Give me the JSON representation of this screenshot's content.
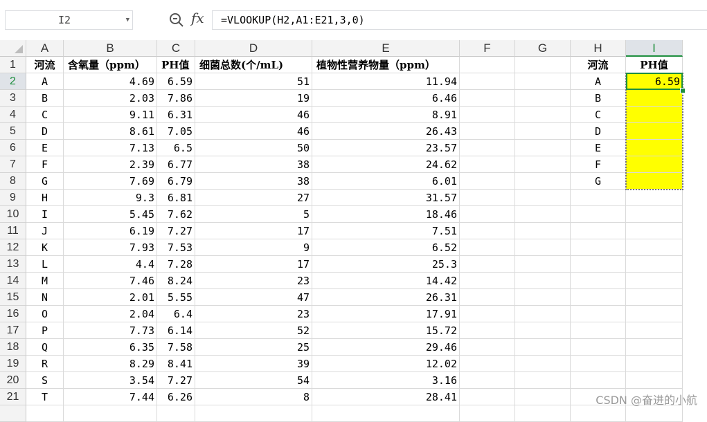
{
  "formula_bar": {
    "name_box": "I2",
    "fx_label": "fx",
    "formula": "=VLOOKUP(H2,A1:E21,3,0)"
  },
  "columns": [
    "A",
    "B",
    "C",
    "D",
    "E",
    "F",
    "G",
    "H",
    "I"
  ],
  "selected_column": "I",
  "selected_row": "2",
  "row_numbers": [
    "1",
    "2",
    "3",
    "4",
    "5",
    "6",
    "7",
    "8",
    "9",
    "10",
    "11",
    "12",
    "13",
    "14",
    "15",
    "16",
    "17",
    "18",
    "19",
    "20",
    "21"
  ],
  "table": {
    "headers": [
      "河流",
      "含氧量（ppm）",
      "PH值",
      "细菌总数(个/mL)",
      "植物性营养物量（ppm）"
    ],
    "rows": [
      [
        "A",
        "4.69",
        "6.59",
        "51",
        "11.94"
      ],
      [
        "B",
        "2.03",
        "7.86",
        "19",
        "6.46"
      ],
      [
        "C",
        "9.11",
        "6.31",
        "46",
        "8.91"
      ],
      [
        "D",
        "8.61",
        "7.05",
        "46",
        "26.43"
      ],
      [
        "E",
        "7.13",
        "6.5",
        "50",
        "23.57"
      ],
      [
        "F",
        "2.39",
        "6.77",
        "38",
        "24.62"
      ],
      [
        "G",
        "7.69",
        "6.79",
        "38",
        "6.01"
      ],
      [
        "H",
        "9.3",
        "6.81",
        "27",
        "31.57"
      ],
      [
        "I",
        "5.45",
        "7.62",
        "5",
        "18.46"
      ],
      [
        "J",
        "6.19",
        "7.27",
        "17",
        "7.51"
      ],
      [
        "K",
        "7.93",
        "7.53",
        "9",
        "6.52"
      ],
      [
        "L",
        "4.4",
        "7.28",
        "17",
        "25.3"
      ],
      [
        "M",
        "7.46",
        "8.24",
        "23",
        "14.42"
      ],
      [
        "N",
        "2.01",
        "5.55",
        "47",
        "26.31"
      ],
      [
        "O",
        "2.04",
        "6.4",
        "23",
        "17.91"
      ],
      [
        "P",
        "7.73",
        "6.14",
        "52",
        "15.72"
      ],
      [
        "Q",
        "6.35",
        "7.58",
        "25",
        "29.46"
      ],
      [
        "R",
        "8.29",
        "8.41",
        "39",
        "12.02"
      ],
      [
        "S",
        "3.54",
        "7.27",
        "54",
        "3.16"
      ],
      [
        "T",
        "7.44",
        "6.26",
        "8",
        "28.41"
      ]
    ]
  },
  "lookup": {
    "headers": [
      "河流",
      "PH值"
    ],
    "rows": [
      [
        "A",
        "6.59"
      ],
      [
        "B",
        ""
      ],
      [
        "C",
        ""
      ],
      [
        "D",
        ""
      ],
      [
        "E",
        ""
      ],
      [
        "F",
        ""
      ],
      [
        "G",
        ""
      ]
    ]
  },
  "watermark": "CSDN @奋进的小航",
  "colors": {
    "highlight": "#ffff00",
    "selection": "#1e8e3e"
  }
}
